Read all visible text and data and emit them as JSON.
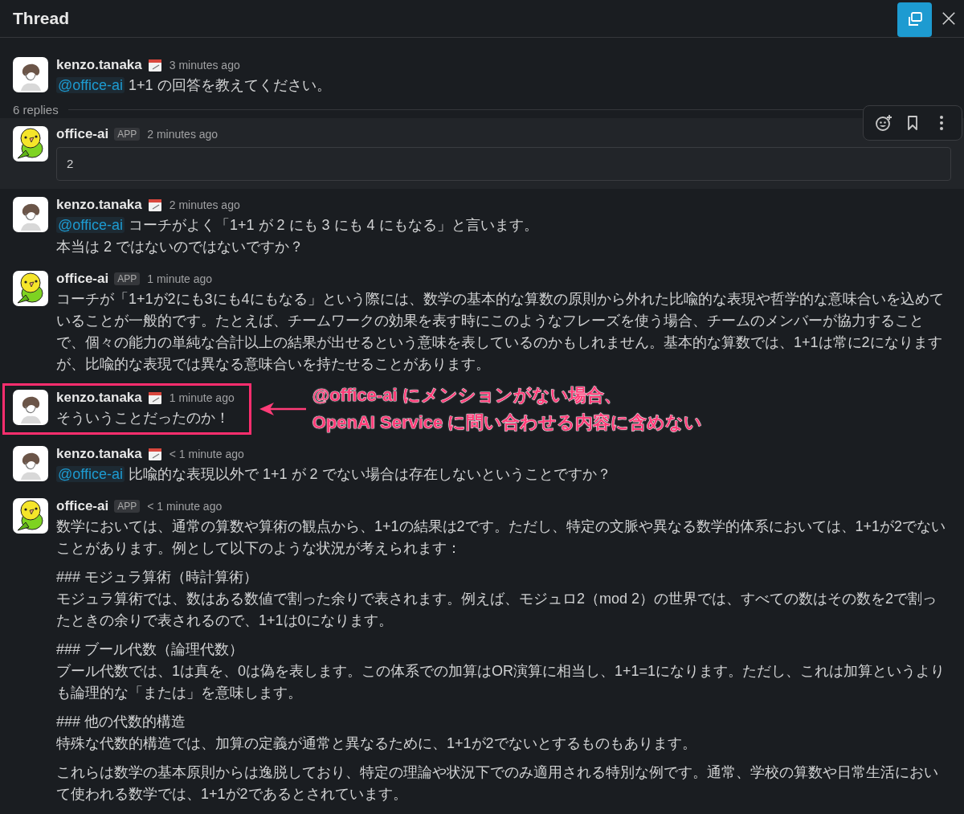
{
  "header": {
    "title": "Thread"
  },
  "thread": {
    "parent": {
      "author": "kenzo.tanaka",
      "kind": "user",
      "status_emoji": true,
      "time": "3 minutes ago",
      "mention": "@office-ai",
      "paragraphs": [
        {
          "lines": [
            "1+1 の回答を教えてください。"
          ]
        }
      ]
    },
    "replies_label": "6 replies",
    "replies": [
      {
        "author": "office-ai",
        "kind": "bot",
        "status_emoji": false,
        "app_badge": "APP",
        "time": "2 minutes ago",
        "highlighted": true,
        "code": "2"
      },
      {
        "author": "kenzo.tanaka",
        "kind": "user",
        "status_emoji": true,
        "time": "2 minutes ago",
        "highlighted": false,
        "mention": "@office-ai",
        "paragraphs": [
          {
            "lines": [
              "コーチがよく「1+1 が 2 にも 3 にも 4 にもなる」と言います。",
              "本当は 2 ではないのではないですか？"
            ]
          }
        ]
      },
      {
        "author": "office-ai",
        "kind": "bot",
        "status_emoji": false,
        "app_badge": "APP",
        "time": "1 minute ago",
        "highlighted": false,
        "paragraphs": [
          {
            "lines": [
              "コーチが「1+1が2にも3にも4にもなる」という際には、数学の基本的な算数の原則から外れた比喩的な表現や哲学的な意味合いを込めていることが一般的です。たとえば、チームワークの効果を表す時にこのようなフレーズを使う場合、チームのメンバーが協力することで、個々の能力の単純な合計以上の結果が出せるという意味を表しているのかもしれません。基本的な算数では、1+1は常に2になりますが、比喩的な表現では異なる意味合いを持たせることがあります。"
            ]
          }
        ]
      },
      {
        "author": "kenzo.tanaka",
        "kind": "user",
        "status_emoji": true,
        "time": "1 minute ago",
        "highlighted": false,
        "paragraphs": [
          {
            "lines": [
              "そういうことだったのか！"
            ]
          }
        ],
        "callout": {
          "lines": [
            "@office-ai にメンションがない場合、",
            "OpenAI Service に問い合わせる内容に含めない"
          ]
        }
      },
      {
        "author": "kenzo.tanaka",
        "kind": "user",
        "status_emoji": true,
        "time": "< 1 minute ago",
        "highlighted": false,
        "mention": "@office-ai",
        "paragraphs": [
          {
            "lines": [
              "比喩的な表現以外で 1+1 が 2 でない場合は存在しないということですか？"
            ]
          }
        ]
      },
      {
        "author": "office-ai",
        "kind": "bot",
        "status_emoji": false,
        "app_badge": "APP",
        "time": "< 1 minute ago",
        "highlighted": false,
        "paragraphs": [
          {
            "lines": [
              "数学においては、通常の算数や算術の観点から、1+1の結果は2です。ただし、特定の文脈や異なる数学的体系においては、1+1が2でないことがあります。例として以下のような状況が考えられます："
            ]
          },
          {
            "lines": [
              "### モジュラ算術（時計算術）",
              "モジュラ算術では、数はある数値で割った余りで表されます。例えば、モジュロ2（mod 2）の世界では、すべての数はその数を2で割ったときの余りで表されるので、1+1は0になります。"
            ]
          },
          {
            "lines": [
              "### ブール代数（論理代数）",
              "ブール代数では、1は真を、0は偽を表します。この体系での加算はOR演算に相当し、1+1=1になります。ただし、これは加算というよりも論理的な「または」を意味します。"
            ]
          },
          {
            "lines": [
              "### 他の代数的構造",
              "特殊な代数的構造では、加算の定義が通常と異なるために、1+1が2でないとするものもあります。"
            ]
          },
          {
            "lines": [
              "これらは数学の基本原則からは逸脱しており、特定の理論や状況下でのみ適用される特別な例です。通常、学校の算数や日常生活において使われる数学では、1+1が2であるとされています。"
            ]
          }
        ]
      }
    ]
  }
}
